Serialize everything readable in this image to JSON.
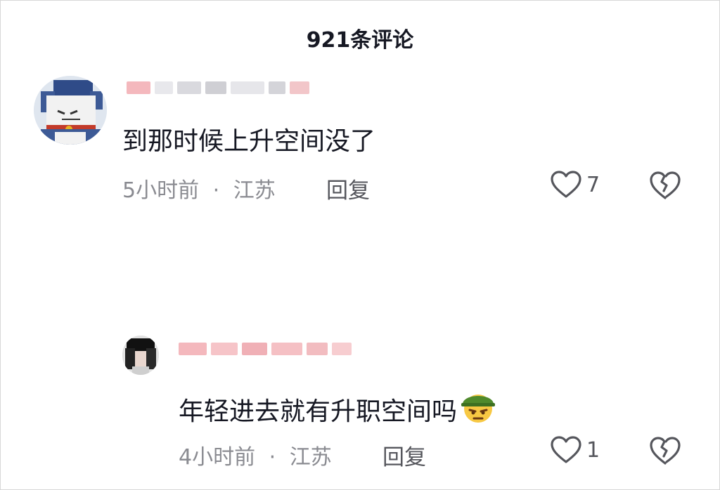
{
  "header": {
    "title": "921条评论"
  },
  "comments": [
    {
      "avatar_icon": "cartoon-cat-avatar-icon",
      "text": "到那时候上升空间没了",
      "time": "5小时前",
      "separator": "·",
      "location": "江苏",
      "reply_label": "回复",
      "likes": "7"
    },
    {
      "avatar_icon": "person-avatar-icon",
      "text": "年轻进去就有升职空间吗",
      "emoji": "soldier-helmet-emoji",
      "time": "4小时前",
      "separator": "·",
      "location": "江苏",
      "reply_label": "回复",
      "likes": "1"
    }
  ],
  "icons": {
    "like": "heart-outline-icon",
    "dislike": "broken-heart-icon"
  },
  "colors": {
    "text": "#161823",
    "meta": "#8a8b91",
    "name_blur": "#f4b8bd"
  }
}
